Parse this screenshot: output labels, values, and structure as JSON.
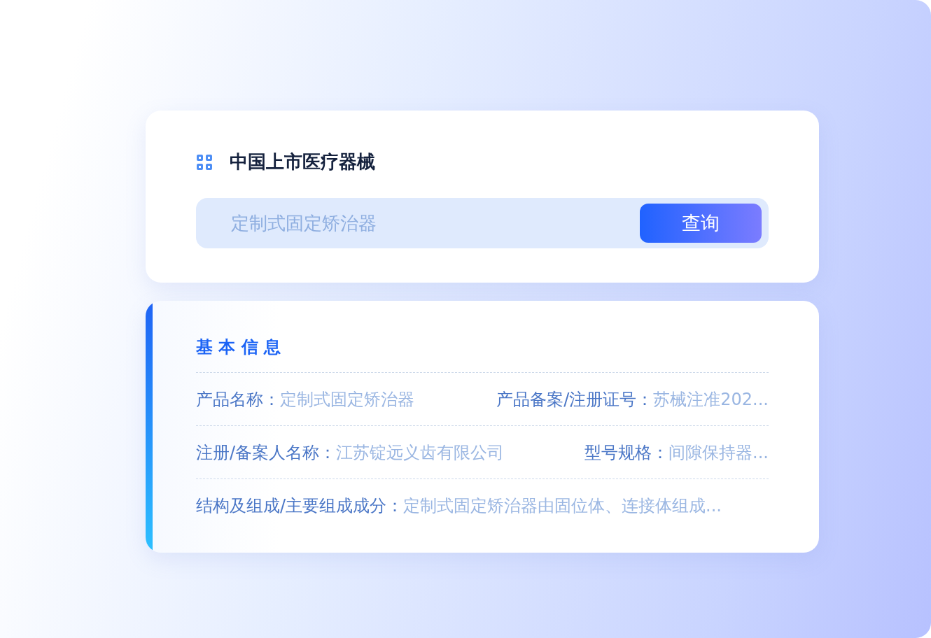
{
  "header": {
    "title": "中国上市医疗器械"
  },
  "search": {
    "placeholder": "定制式固定矫治器",
    "button": "查询"
  },
  "info": {
    "title": "基 本 信 息",
    "rows": [
      [
        {
          "label": "产品名称：",
          "value": "定制式固定矫治器"
        },
        {
          "label": "产品备案/注册证号：",
          "value": "苏械注准202..."
        }
      ],
      [
        {
          "label": "注册/备案人名称：",
          "value": "江苏锭远义齿有限公司"
        },
        {
          "label": "型号规格：",
          "value": "间隙保持器..."
        }
      ],
      [
        {
          "label": "结构及组成/主要组成成分：",
          "value": "定制式固定矫治器由固位体、连接体组成..."
        }
      ]
    ]
  }
}
